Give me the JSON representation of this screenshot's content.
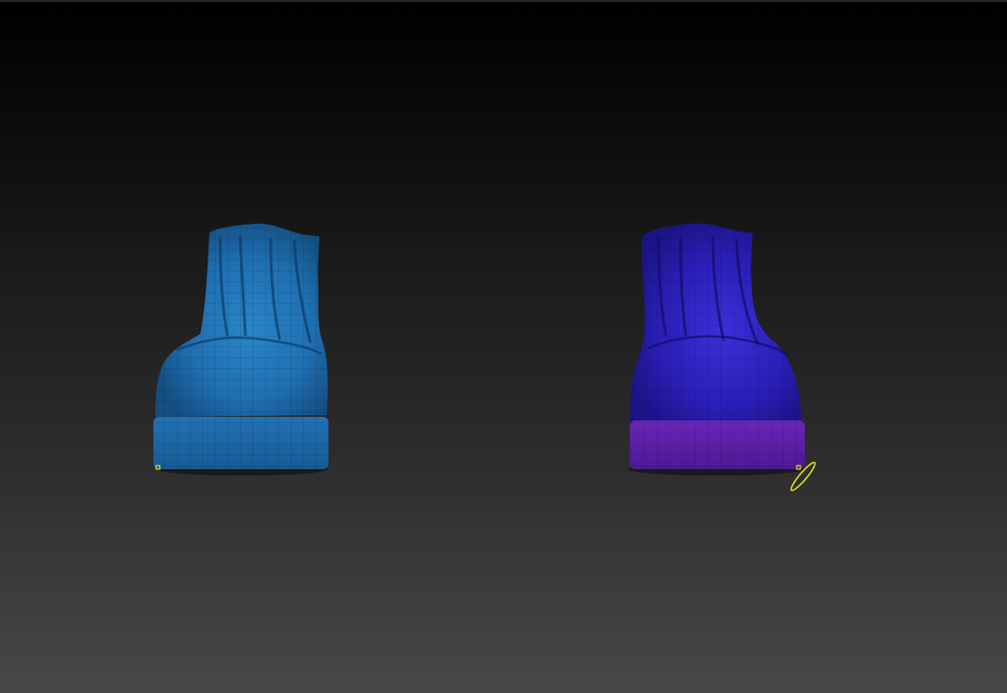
{
  "app": {
    "view": "3d-viewport"
  },
  "scene": {
    "background_top": "#000000",
    "background_bottom": "#484848",
    "models": [
      {
        "name": "boot-left",
        "upper_color": "#1f6fb0",
        "sole_color": "#1c66a6",
        "selected": false
      },
      {
        "name": "boot-right",
        "upper_color": "#2b1fb8",
        "sole_color": "#5a1fa8",
        "selected": true
      }
    ],
    "gizmo": {
      "icon": "rotation-ring-icon",
      "color": "#e2e21a"
    },
    "pivot_marker_color": "#e2e21a"
  }
}
